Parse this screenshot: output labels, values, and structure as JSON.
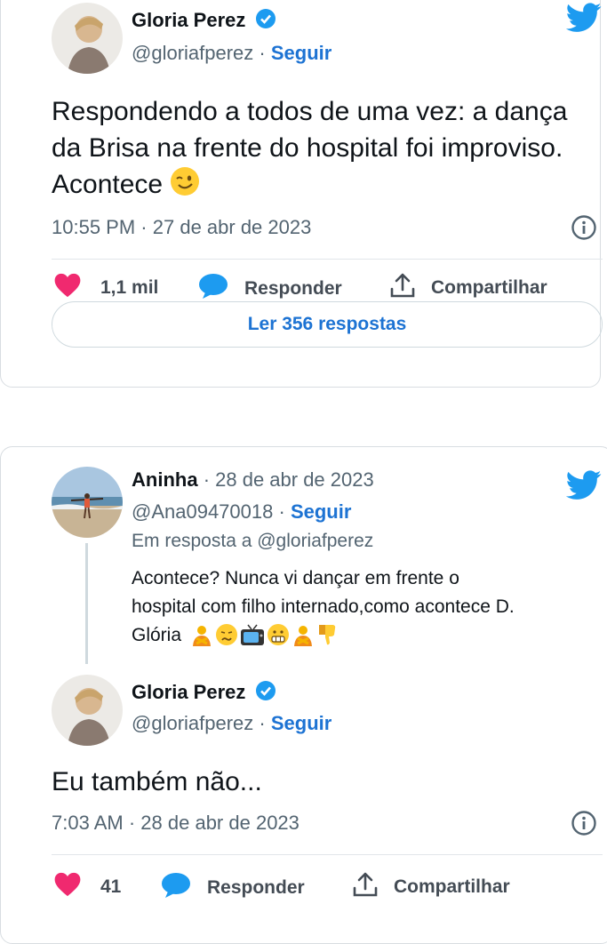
{
  "tweet1": {
    "author_name": "Gloria Perez",
    "handle": "@gloriafperez",
    "dot": "·",
    "follow": "Seguir",
    "text": "Respondendo a todos de uma vez: a dança da Brisa na frente do hospital foi improviso. Acontece",
    "time": "10:55 PM",
    "date": "27 de abr de 2023",
    "likes": "1,1 mil",
    "reply_label": "Responder",
    "share_label": "Compartilhar",
    "read_replies": "Ler 356 respostas"
  },
  "reply": {
    "author_name": "Aninha",
    "date_line": "· 28 de abr de 2023",
    "handle": "@Ana09470018",
    "dot": "·",
    "follow": "Seguir",
    "in_reply_to": "Em resposta a @gloriafperez",
    "text_line1": "Acontece? Nunca vi dançar em frente o",
    "text_line2": "hospital com filho internado,como acontece D.",
    "text_line3": "Glória"
  },
  "tweet2": {
    "author_name": "Gloria Perez",
    "handle": "@gloriafperez",
    "dot": "·",
    "follow": "Seguir",
    "text": "Eu também não...",
    "time": "7:03 AM",
    "date": "28 de abr de 2023",
    "likes": "41",
    "reply_label": "Responder",
    "share_label": "Compartilhar"
  },
  "colors": {
    "twitter_blue": "#1d9bf0",
    "link_blue": "#1d73d3",
    "heart": "#f0296f",
    "verified": "#1d9bf0"
  },
  "icons": [
    "twitter-bird-icon",
    "verified-badge-icon",
    "info-icon",
    "heart-icon",
    "reply-bubble-icon",
    "share-icon",
    "wink-emoji"
  ]
}
